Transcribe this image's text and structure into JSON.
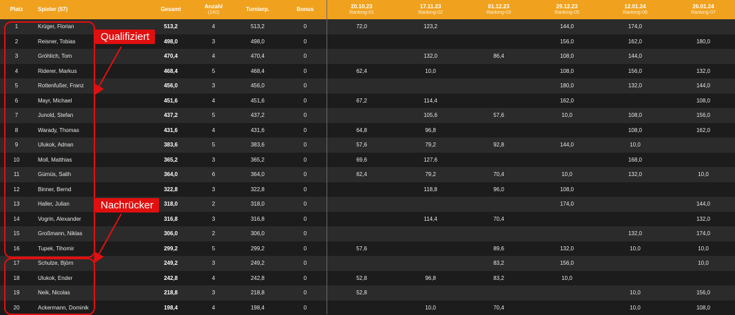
{
  "header": {
    "platz": "Platz",
    "spieler": "Spieler (57)",
    "gesamt": "Gesamt",
    "anzahl": "Anzahl",
    "anzahl_sub": "(140)",
    "turnierp": "Turnierp.",
    "bonus": "Bonus",
    "dates": [
      {
        "date": "20.10.23",
        "ranking": "Ranking-01"
      },
      {
        "date": "17.11.23",
        "ranking": "Ranking-02"
      },
      {
        "date": "01.12.23",
        "ranking": "Ranking-03"
      },
      {
        "date": "29.12.23",
        "ranking": "Ranking-05"
      },
      {
        "date": "12.01.24",
        "ranking": "Ranking-06"
      },
      {
        "date": "26.01.24",
        "ranking": "Ranking-07"
      }
    ]
  },
  "rows": [
    {
      "platz": "1",
      "spieler": "Krüger, Florian",
      "gesamt": "513,2",
      "anzahl": "4",
      "turnierp": "513,2",
      "bonus": "0",
      "r": [
        "72,0",
        "123,2",
        "",
        "144,0",
        "174,0",
        ""
      ]
    },
    {
      "platz": "2",
      "spieler": "Reisner, Tobias",
      "gesamt": "498,0",
      "anzahl": "3",
      "turnierp": "498,0",
      "bonus": "0",
      "r": [
        "",
        "",
        "",
        "156,0",
        "162,0",
        "180,0"
      ]
    },
    {
      "platz": "3",
      "spieler": "Gröhlich, Tom",
      "gesamt": "470,4",
      "anzahl": "4",
      "turnierp": "470,4",
      "bonus": "0",
      "r": [
        "",
        "132,0",
        "86,4",
        "108,0",
        "144,0",
        ""
      ]
    },
    {
      "platz": "4",
      "spieler": "Riderer, Markus",
      "gesamt": "468,4",
      "anzahl": "5",
      "turnierp": "468,4",
      "bonus": "0",
      "r": [
        "62,4",
        "10,0",
        "",
        "108,0",
        "156,0",
        "132,0"
      ]
    },
    {
      "platz": "5",
      "spieler": "Rottenfußer, Franz",
      "gesamt": "456,0",
      "anzahl": "3",
      "turnierp": "456,0",
      "bonus": "0",
      "r": [
        "",
        "",
        "",
        "180,0",
        "132,0",
        "144,0"
      ]
    },
    {
      "platz": "6",
      "spieler": "Mayr, Michael",
      "gesamt": "451,6",
      "anzahl": "4",
      "turnierp": "451,6",
      "bonus": "0",
      "r": [
        "67,2",
        "114,4",
        "",
        "162,0",
        "",
        "108,0"
      ]
    },
    {
      "platz": "7",
      "spieler": "Junold, Stefan",
      "gesamt": "437,2",
      "anzahl": "5",
      "turnierp": "437,2",
      "bonus": "0",
      "r": [
        "",
        "105,6",
        "57,6",
        "10,0",
        "108,0",
        "156,0"
      ]
    },
    {
      "platz": "8",
      "spieler": "Warady, Thomas",
      "gesamt": "431,6",
      "anzahl": "4",
      "turnierp": "431,6",
      "bonus": "0",
      "r": [
        "64,8",
        "96,8",
        "",
        "",
        "108,0",
        "162,0"
      ]
    },
    {
      "platz": "9",
      "spieler": "Ulukok, Adnan",
      "gesamt": "383,6",
      "anzahl": "5",
      "turnierp": "383,6",
      "bonus": "0",
      "r": [
        "57,6",
        "79,2",
        "92,8",
        "144,0",
        "10,0",
        ""
      ]
    },
    {
      "platz": "10",
      "spieler": "Moll, Matthias",
      "gesamt": "365,2",
      "anzahl": "3",
      "turnierp": "365,2",
      "bonus": "0",
      "r": [
        "69,6",
        "127,6",
        "",
        "",
        "168,0",
        ""
      ]
    },
    {
      "platz": "11",
      "spieler": "Gümüs, Salih",
      "gesamt": "364,0",
      "anzahl": "6",
      "turnierp": "364,0",
      "bonus": "0",
      "r": [
        "62,4",
        "79,2",
        "70,4",
        "10,0",
        "132,0",
        "10,0"
      ]
    },
    {
      "platz": "12",
      "spieler": "Binner, Bernd",
      "gesamt": "322,8",
      "anzahl": "3",
      "turnierp": "322,8",
      "bonus": "0",
      "r": [
        "",
        "118,8",
        "96,0",
        "108,0",
        "",
        ""
      ]
    },
    {
      "platz": "13",
      "spieler": "Haller, Julian",
      "gesamt": "318,0",
      "anzahl": "2",
      "turnierp": "318,0",
      "bonus": "0",
      "r": [
        "",
        "",
        "",
        "174,0",
        "",
        "144,0"
      ]
    },
    {
      "platz": "14",
      "spieler": "Vogrin, Alexander",
      "gesamt": "316,8",
      "anzahl": "3",
      "turnierp": "316,8",
      "bonus": "0",
      "r": [
        "",
        "114,4",
        "70,4",
        "",
        "",
        "132,0"
      ]
    },
    {
      "platz": "15",
      "spieler": "Großmann, Niklas",
      "gesamt": "306,0",
      "anzahl": "2",
      "turnierp": "306,0",
      "bonus": "0",
      "r": [
        "",
        "",
        "",
        "",
        "132,0",
        "174,0"
      ]
    },
    {
      "platz": "16",
      "spieler": "Tupek, Tihomir",
      "gesamt": "299,2",
      "anzahl": "5",
      "turnierp": "299,2",
      "bonus": "0",
      "r": [
        "57,6",
        "",
        "89,6",
        "132,0",
        "10,0",
        "10,0"
      ]
    },
    {
      "platz": "17",
      "spieler": "Schulze, Björn",
      "gesamt": "249,2",
      "anzahl": "3",
      "turnierp": "249,2",
      "bonus": "0",
      "r": [
        "",
        "",
        "83,2",
        "156,0",
        "",
        "10,0"
      ]
    },
    {
      "platz": "18",
      "spieler": "Ulukok, Ender",
      "gesamt": "242,8",
      "anzahl": "4",
      "turnierp": "242,8",
      "bonus": "0",
      "r": [
        "52,8",
        "96,8",
        "83,2",
        "10,0",
        "",
        ""
      ]
    },
    {
      "platz": "19",
      "spieler": "Neik, Nicolas",
      "gesamt": "218,8",
      "anzahl": "3",
      "turnierp": "218,8",
      "bonus": "0",
      "r": [
        "52,8",
        "",
        "",
        "",
        "10,0",
        "156,0"
      ]
    },
    {
      "platz": "20",
      "spieler": "Ackermann, Dominik",
      "gesamt": "198,4",
      "anzahl": "4",
      "turnierp": "198,4",
      "bonus": "0",
      "r": [
        "",
        "10,0",
        "70,4",
        "",
        "10,0",
        "108,0"
      ]
    }
  ],
  "annotations": {
    "qualified_label": "Qualifiziert",
    "successor_label": "Nachrücker",
    "color": "#e01010"
  },
  "colors": {
    "header_bg": "#f0a21e",
    "row_odd": "#2b2b2b",
    "row_even": "#1c1c1c"
  }
}
